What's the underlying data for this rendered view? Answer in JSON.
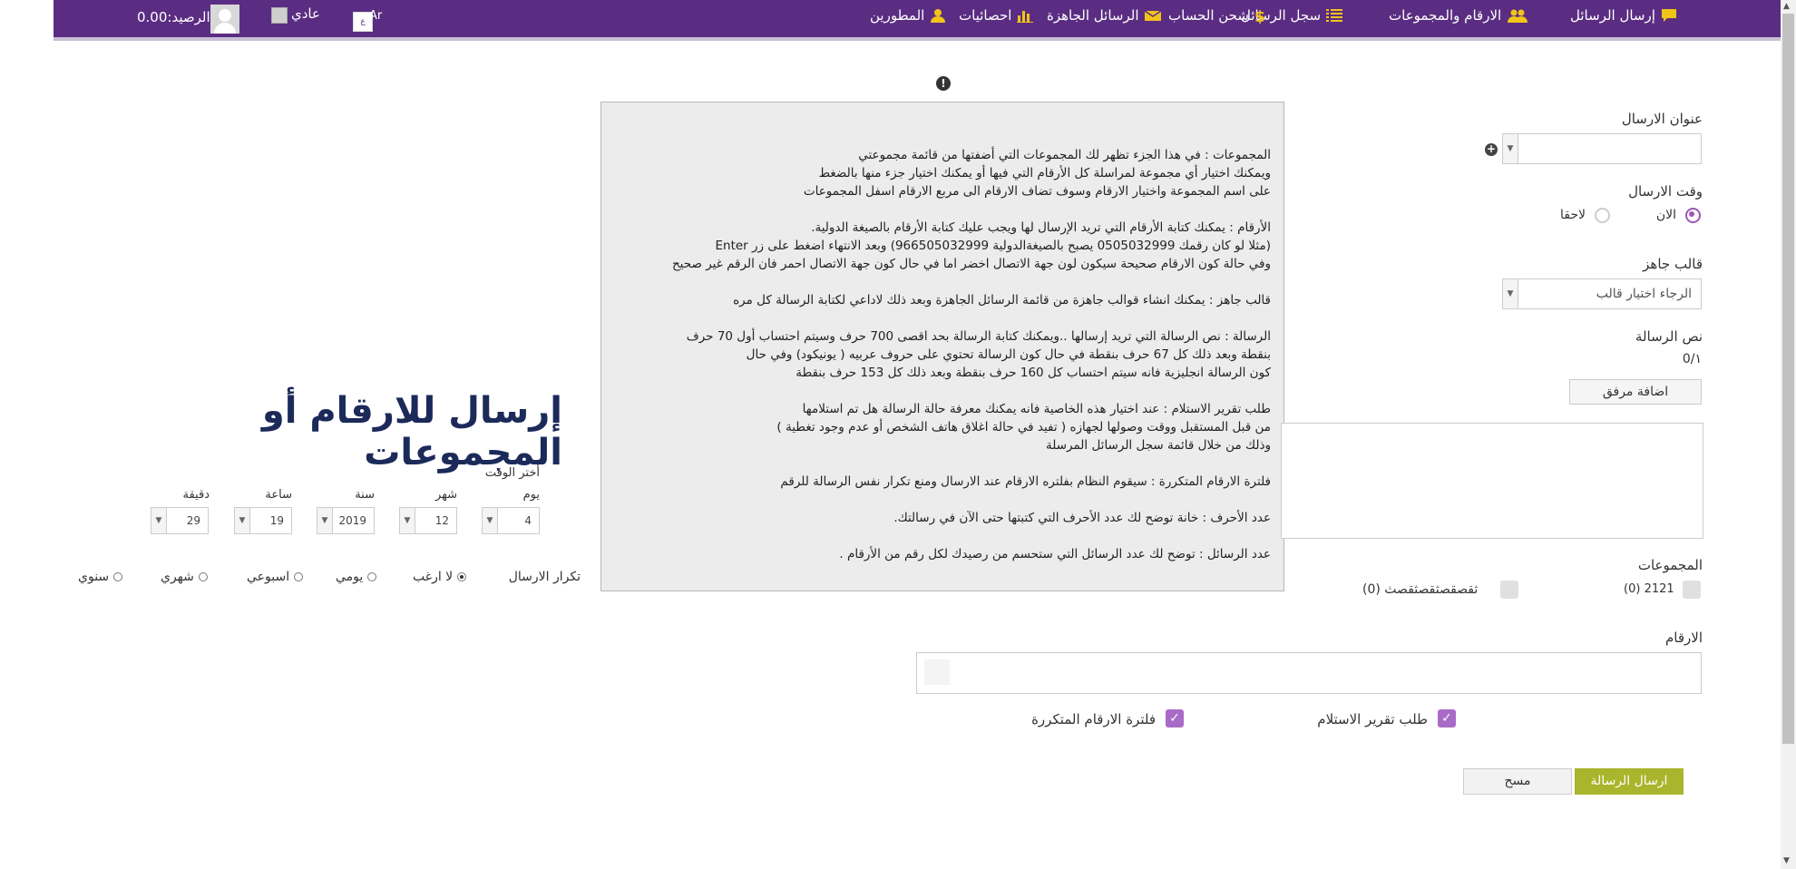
{
  "nav": {
    "items": [
      {
        "label": "إرسال الرسائل",
        "icon": "chat-icon"
      },
      {
        "label": "الارقام والمجموعات",
        "icon": "users-icon"
      },
      {
        "label": "سجل الرسائل",
        "icon": "list-icon"
      },
      {
        "label": "شحن الحساب",
        "icon": "dollar-icon"
      },
      {
        "label": "الرسائل الجاهزة",
        "icon": "envelope-icon"
      },
      {
        "label": "احصائيات",
        "icon": "bar-chart-icon"
      },
      {
        "label": "المطورين",
        "icon": "user-icon"
      }
    ],
    "balance_label": "الرصيد:0.00",
    "status_label": "عادي",
    "lang_label": "Ar"
  },
  "info": {
    "paragraphs": [
      "المجموعات : في هذا الجزء تظهر لك المجموعات التي أضفتها من قائمة مجموعتي\nويمكنك اختيار أي مجموعة لمراسلة كل الأرقام التي فيها أو يمكنك اختيار جزء منها بالضغط\nعلى اسم المجموعة واختيار الارقام وسوف تضاف الارقام الى مربع الارقام اسفل المجموعات",
      "الأرقام : يمكنك كتابة الأرقام التي تريد الإرسال لها ويجب عليك كتابة الأرقام بالصيغة الدولية.\n(مثلا لو كان رقمك 0505032999 يصبح بالصيغةالدولية 966505032999) وبعد الانتهاء اضغط على زر Enter\nوفي حالة كون الارقام صحيحة سيكون لون جهة الاتصال اخضر اما في حال كون جهة الاتصال احمر فان الرقم غير صحيح",
      "قالب جاهز : يمكنك انشاء قوالب جاهزة من قائمة الرسائل الجاهزة وبعد ذلك لاداعي لكتابة الرسالة كل مره",
      "الرسالة : نص الرسالة التي تريد إرسالها ..ويمكنك كتابة الرسالة بحد اقصى 700 حرف وسيتم احتساب أول 70 حرف\nبنقطة وبعد ذلك كل 67 حرف بنقطة في حال كون الرسالة تحتوي على حروف عربيه ( يونيكود) وفي حال\nكون الرسالة انجليزية فانه سيتم احتساب كل 160 حرف بنقطة وبعد ذلك كل 153 حرف بنقطة",
      "طلب تقرير الاستلام : عند اختيار هذه الخاصية فانه يمكنك معرفة حالة الرسالة هل تم استلامها\nمن قبل المستقبل ووقت وصولها لجهازه ( تفيد في حالة اغلاق هاتف الشخص أو عدم وجود تغطية )\nوذلك من خلال قائمة سجل الرسائل المرسلة",
      "فلترة الارقام المتكررة : سيقوم النظام بفلتره الارقام عند الارسال ومنع تكرار نفس الرسالة للرقم",
      "عدد الأحرف : خانة توضح لك عدد الأحرف التي كتبتها حتى الآن في رسالتك.",
      "عدد الرسائل : توضح لك عدد الرسائل التي ستحسم من رصيدك لكل رقم من الأرقام ."
    ]
  },
  "form": {
    "sender_label": "عنوان الارسال",
    "sender_value": "",
    "send_time_label": "وقت الارسال",
    "now_label": "الان",
    "later_label": "لاحقا",
    "template_label": "قالب جاهز",
    "template_value": "الرجاء اختيار قالب",
    "message_label": "نص الرسالة",
    "counter": "0/١",
    "attach_button": "اضافة مرفق",
    "groups_label": "المجموعات",
    "groups": [
      {
        "label": "2121 (0)"
      },
      {
        "label": "ثقصقصثقصثقصث (0)"
      }
    ],
    "numbers_label": "الارقام",
    "delivery_report_label": "طلب تقرير الاستلام",
    "filter_duplicates_label": "فلترة الارقام المتكررة",
    "send_button": "ارسال الرسالة",
    "clear_button": "مسح"
  },
  "schedule": {
    "title": "إرسال للارقام أو المجموعات",
    "choose_time_label": "أختر الوقت",
    "fields": [
      {
        "label": "يوم",
        "value": "4"
      },
      {
        "label": "شهر",
        "value": "12"
      },
      {
        "label": "سنة",
        "value": "2019"
      },
      {
        "label": "ساعة",
        "value": "19"
      },
      {
        "label": "دقيقة",
        "value": "29"
      }
    ],
    "repeat_label": "تكرار الارسال",
    "repeat_options": [
      {
        "label": "لا ارغب",
        "selected": true
      },
      {
        "label": "يومي",
        "selected": false
      },
      {
        "label": "اسبوعي",
        "selected": false
      },
      {
        "label": "شهري",
        "selected": false
      },
      {
        "label": "سنوي",
        "selected": false
      }
    ]
  },
  "colors": {
    "nav_bg": "#5a2d82",
    "accent": "#a96bc7",
    "send_button": "#a9b52c",
    "title": "#1c2a5a"
  }
}
